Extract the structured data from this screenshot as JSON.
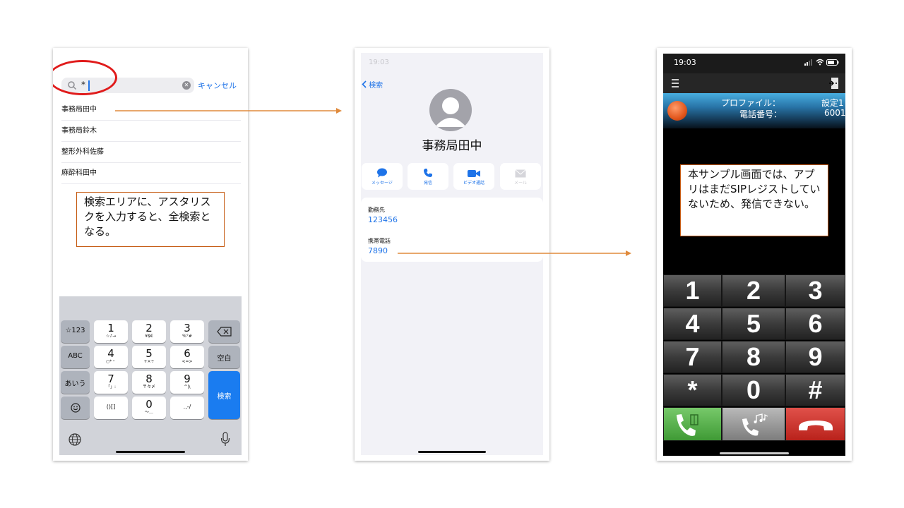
{
  "search_screen": {
    "search": {
      "value": "*",
      "placeholder": ""
    },
    "cancel_label": "キャンセル",
    "results": [
      "事務局田中",
      "事務局鈴木",
      "整形外科佐藤",
      "麻酔科田中"
    ],
    "note": "検索エリアに、アスタリスクを入力すると、全検索となる。",
    "keyboard": {
      "row1": [
        {
          "main": "1",
          "sub": "☆♪→"
        },
        {
          "main": "2",
          "sub": "¥$€"
        },
        {
          "main": "3",
          "sub": "%°#"
        }
      ],
      "row2": [
        {
          "main": "4",
          "sub": "○*・"
        },
        {
          "main": "5",
          "sub": "+×÷"
        },
        {
          "main": "6",
          "sub": "<=>"
        }
      ],
      "row3": [
        {
          "main": "7",
          "sub": "「」:"
        },
        {
          "main": "8",
          "sub": "〒々〆"
        },
        {
          "main": "9",
          "sub": "^|\\"
        }
      ],
      "row4": [
        {
          "main": "()[]",
          "sub": ""
        },
        {
          "main": "0",
          "sub": "〜…"
        },
        {
          "main": ".,-/",
          "sub": ""
        }
      ],
      "mode_num": "☆123",
      "mode_abc": "ABC",
      "mode_kana": "あいう",
      "space": "空白",
      "search": "検索"
    }
  },
  "contact_screen": {
    "status_time": "19:03",
    "back_label": "検索",
    "name": "事務局田中",
    "actions": [
      {
        "label": "メッセージ",
        "icon": "message-icon"
      },
      {
        "label": "発信",
        "icon": "phone-icon"
      },
      {
        "label": "ビデオ通話",
        "icon": "video-icon"
      },
      {
        "label": "メール",
        "icon": "mail-icon"
      }
    ],
    "fields": [
      {
        "label": "勤務先",
        "value": "123456"
      },
      {
        "label": "携帯電話",
        "value": "7890"
      }
    ]
  },
  "softphone_screen": {
    "status_time": "19:03",
    "profile_label": "プロファイル：",
    "profile_value": "設定1",
    "phone_label": "電話番号：",
    "phone_value": "6001",
    "note": "本サンプル画面では、アプリはまだSIPレジストしていないため、発信できない。",
    "keys": [
      "1",
      "2",
      "3",
      "4",
      "5",
      "6",
      "7",
      "8",
      "9",
      "*",
      "0",
      "#"
    ],
    "colors": {
      "call": "#5cb85c",
      "hangup": "#d9342b",
      "transfer": "#9a9a9a"
    }
  },
  "colors": {
    "accent_blue": "#1e73e8",
    "arrow": "#e08a3c",
    "highlight_ring": "#e01b1b"
  }
}
